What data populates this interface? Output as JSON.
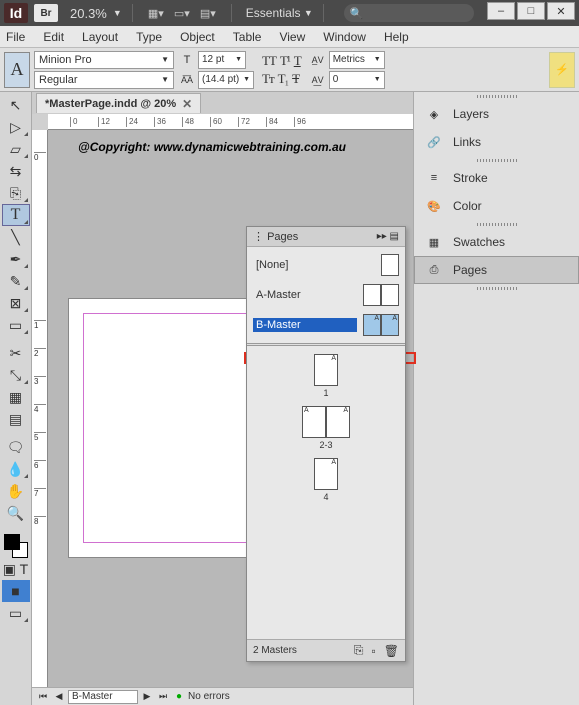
{
  "app": {
    "id_badge": "Id",
    "br_badge": "Br",
    "zoom": "20.3%",
    "workspace": "Essentials"
  },
  "window_buttons": {
    "min": "–",
    "max": "□",
    "close": "✕"
  },
  "menu": [
    "File",
    "Edit",
    "Layout",
    "Type",
    "Object",
    "Table",
    "View",
    "Window",
    "Help"
  ],
  "control": {
    "char": "A",
    "font": "Minion Pro",
    "style": "Regular",
    "size": "12 pt",
    "leading": "(14.4 pt)",
    "kerning": "Metrics",
    "tracking": "0"
  },
  "doc": {
    "tab": "*MasterPage.indd @ 20%",
    "copyright": "@Copyright: www.dynamicwebtraining.com.au"
  },
  "ruler_ticks": [
    "0",
    "12",
    "24",
    "36",
    "48",
    "60",
    "72",
    "84",
    "96"
  ],
  "status": {
    "page": "B-Master",
    "errors": "No errors"
  },
  "right_panels": [
    {
      "name": "layers",
      "label": "Layers"
    },
    {
      "name": "links",
      "label": "Links"
    },
    {
      "name": "stroke",
      "label": "Stroke"
    },
    {
      "name": "color",
      "label": "Color"
    },
    {
      "name": "swatches",
      "label": "Swatches"
    },
    {
      "name": "pages",
      "label": "Pages"
    }
  ],
  "pages_panel": {
    "title": "Pages",
    "masters": [
      {
        "label": "[None]",
        "thumbs": 1,
        "selected": false,
        "a": false
      },
      {
        "label": "A-Master",
        "thumbs": 2,
        "selected": false,
        "a": false
      },
      {
        "label": "B-Master",
        "thumbs": 2,
        "selected": true,
        "a": true
      }
    ],
    "pages": [
      {
        "label": "1",
        "thumbs": 1
      },
      {
        "label": "2-3",
        "thumbs": 2
      },
      {
        "label": "4",
        "thumbs": 1
      }
    ],
    "footer": "2 Masters"
  }
}
